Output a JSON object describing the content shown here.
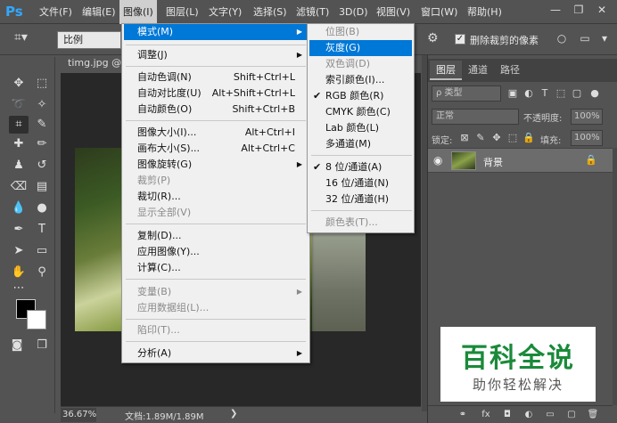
{
  "app": {
    "logo": "Ps"
  },
  "menubar": {
    "items": [
      {
        "label": "文件(F)"
      },
      {
        "label": "编辑(E)"
      },
      {
        "label": "图像(I)"
      },
      {
        "label": "图层(L)"
      },
      {
        "label": "文字(Y)"
      },
      {
        "label": "选择(S)"
      },
      {
        "label": "滤镜(T)"
      },
      {
        "label": "3D(D)"
      },
      {
        "label": "视图(V)"
      },
      {
        "label": "窗口(W)"
      },
      {
        "label": "帮助(H)"
      }
    ],
    "active": "图像(I)",
    "window_controls": {
      "minimize": "—",
      "restore": "❐",
      "close": "✕"
    }
  },
  "options": {
    "tool_glyph": "⌗▾",
    "ratio_value": "比例",
    "checkbox_checked": "✓",
    "checkbox_label": "删除裁剪的像素"
  },
  "document": {
    "tab_label": "timg.jpg @",
    "zoom": "36.67%",
    "doc_size": "文档:1.89M/1.89M",
    "status_arrow": "❯"
  },
  "image_menu": {
    "items": [
      {
        "label": "模式(M)",
        "submenu": true,
        "highlight": true
      },
      {
        "label": "调整(J)",
        "submenu": true
      },
      {
        "label": "自动色调(N)",
        "shortcut": "Shift+Ctrl+L"
      },
      {
        "label": "自动对比度(U)",
        "shortcut": "Alt+Shift+Ctrl+L"
      },
      {
        "label": "自动颜色(O)",
        "shortcut": "Shift+Ctrl+B"
      },
      {
        "label": "图像大小(I)...",
        "shortcut": "Alt+Ctrl+I"
      },
      {
        "label": "画布大小(S)...",
        "shortcut": "Alt+Ctrl+C"
      },
      {
        "label": "图像旋转(G)",
        "submenu": true
      },
      {
        "label": "裁剪(P)",
        "disabled": true
      },
      {
        "label": "裁切(R)..."
      },
      {
        "label": "显示全部(V)",
        "disabled": true
      },
      {
        "label": "复制(D)..."
      },
      {
        "label": "应用图像(Y)..."
      },
      {
        "label": "计算(C)..."
      },
      {
        "label": "变量(B)",
        "submenu": true,
        "disabled": true
      },
      {
        "label": "应用数据组(L)...",
        "disabled": true
      },
      {
        "label": "陷印(T)...",
        "disabled": true
      },
      {
        "label": "分析(A)",
        "submenu": true
      }
    ]
  },
  "mode_submenu": {
    "items": [
      {
        "label": "位图(B)",
        "disabled": true
      },
      {
        "label": "灰度(G)",
        "highlight": true
      },
      {
        "label": "双色调(D)",
        "disabled": true
      },
      {
        "label": "索引颜色(I)..."
      },
      {
        "label": "RGB 颜色(R)",
        "checked": true
      },
      {
        "label": "CMYK 颜色(C)"
      },
      {
        "label": "Lab 颜色(L)"
      },
      {
        "label": "多通道(M)"
      },
      {
        "label": "8 位/通道(A)",
        "checked": true
      },
      {
        "label": "16 位/通道(N)"
      },
      {
        "label": "32 位/通道(H)"
      },
      {
        "label": "颜色表(T)...",
        "disabled": true
      }
    ],
    "check_glyph": "✔"
  },
  "layers_panel": {
    "tabs": [
      {
        "label": "图层"
      },
      {
        "label": "通道"
      },
      {
        "label": "路径"
      }
    ],
    "filter_label": "ρ 类型",
    "blend_mode": "正常",
    "opacity_label": "不透明度:",
    "opacity_value": "100%",
    "lock_label": "锁定:",
    "fill_label": "填充:",
    "fill_value": "100%",
    "layer": {
      "name": "背景"
    }
  },
  "watermark": {
    "title": "百科全说",
    "subtitle": "助你轻松解决"
  },
  "colors": {
    "accent": "#0078d7",
    "ps_blue": "#31a8ff",
    "watermark_green": "#1a8a3a"
  }
}
